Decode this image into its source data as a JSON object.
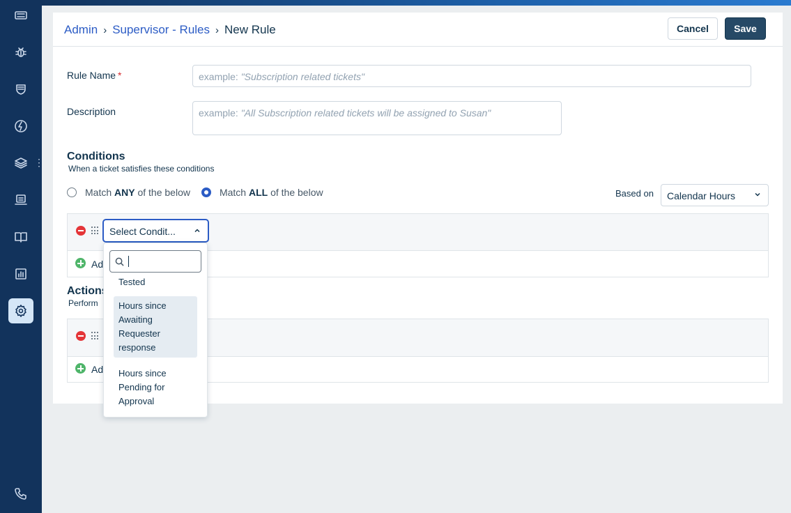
{
  "breadcrumb": {
    "items": [
      "Admin",
      "Supervisor - Rules"
    ],
    "separator": "›",
    "current": "New Rule"
  },
  "actions": {
    "cancel_label": "Cancel",
    "save_label": "Save"
  },
  "form": {
    "rule_name_label": "Rule Name",
    "required_marker": "*",
    "rule_name_placeholder_prefix": "example: ",
    "rule_name_placeholder_example": "\"Subscription related tickets\"",
    "description_label": "Description",
    "description_placeholder_prefix": "example: ",
    "description_placeholder_example": "\"All Subscription related tickets will be assigned to Susan\""
  },
  "conditions": {
    "title": "Conditions",
    "subtitle": "When a ticket satisfies these conditions",
    "match_any": {
      "pre": "Match ",
      "bold": "ANY",
      "post": " of the below",
      "checked": false
    },
    "match_all": {
      "pre": "Match ",
      "bold": "ALL",
      "post": " of the below",
      "checked": true
    },
    "based_on_label": "Based on",
    "based_on_value": "Calendar Hours",
    "select_placeholder": "Select Condit...",
    "add_label_partial": "Ad"
  },
  "actions_section": {
    "title_partial": "Actions",
    "subtitle_partial": "Perform",
    "add_label_partial": "Ad"
  },
  "dropdown": {
    "search_value": "",
    "options": [
      {
        "label": "Tested",
        "highlighted": false
      },
      {
        "label": "Hours since Awaiting Requester response",
        "highlighted": true
      },
      {
        "label": "Hours since Pending for Approval",
        "highlighted": false
      }
    ]
  },
  "colors": {
    "sidebar": "#12335c",
    "link": "#2c5cc5",
    "primary_button": "#264966",
    "danger": "#e43538",
    "success": "#4fb56a"
  },
  "sidebar_icons": [
    "tickets-icon",
    "bug-icon",
    "shield-icon",
    "lightning-icon",
    "layers-icon",
    "inbox-icon",
    "book-icon",
    "reports-icon",
    "settings-icon",
    "phone-icon"
  ]
}
